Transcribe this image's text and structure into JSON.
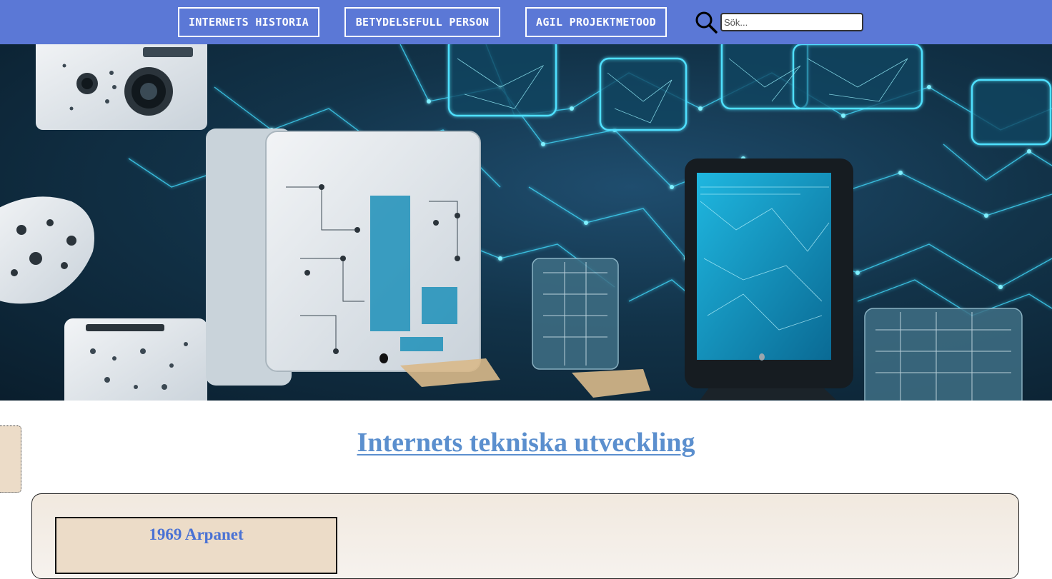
{
  "nav": {
    "items": [
      {
        "label": "INTERNETS HISTORIA"
      },
      {
        "label": "BETYDELSEFULL PERSON"
      },
      {
        "label": "AGIL PROJEKTMETOOD"
      }
    ],
    "search": {
      "placeholder": "Sök...",
      "value": ""
    }
  },
  "hero": {
    "icon": "network-computers-illustration"
  },
  "main": {
    "title": "Internets tekniska utveckling",
    "timeline": [
      {
        "title": "1969 Arpanet"
      }
    ]
  },
  "colors": {
    "nav_bg": "#5b78d6",
    "title": "#5b8fce",
    "card_bg": "#ecdcc8",
    "card_title": "#4a72d4"
  }
}
